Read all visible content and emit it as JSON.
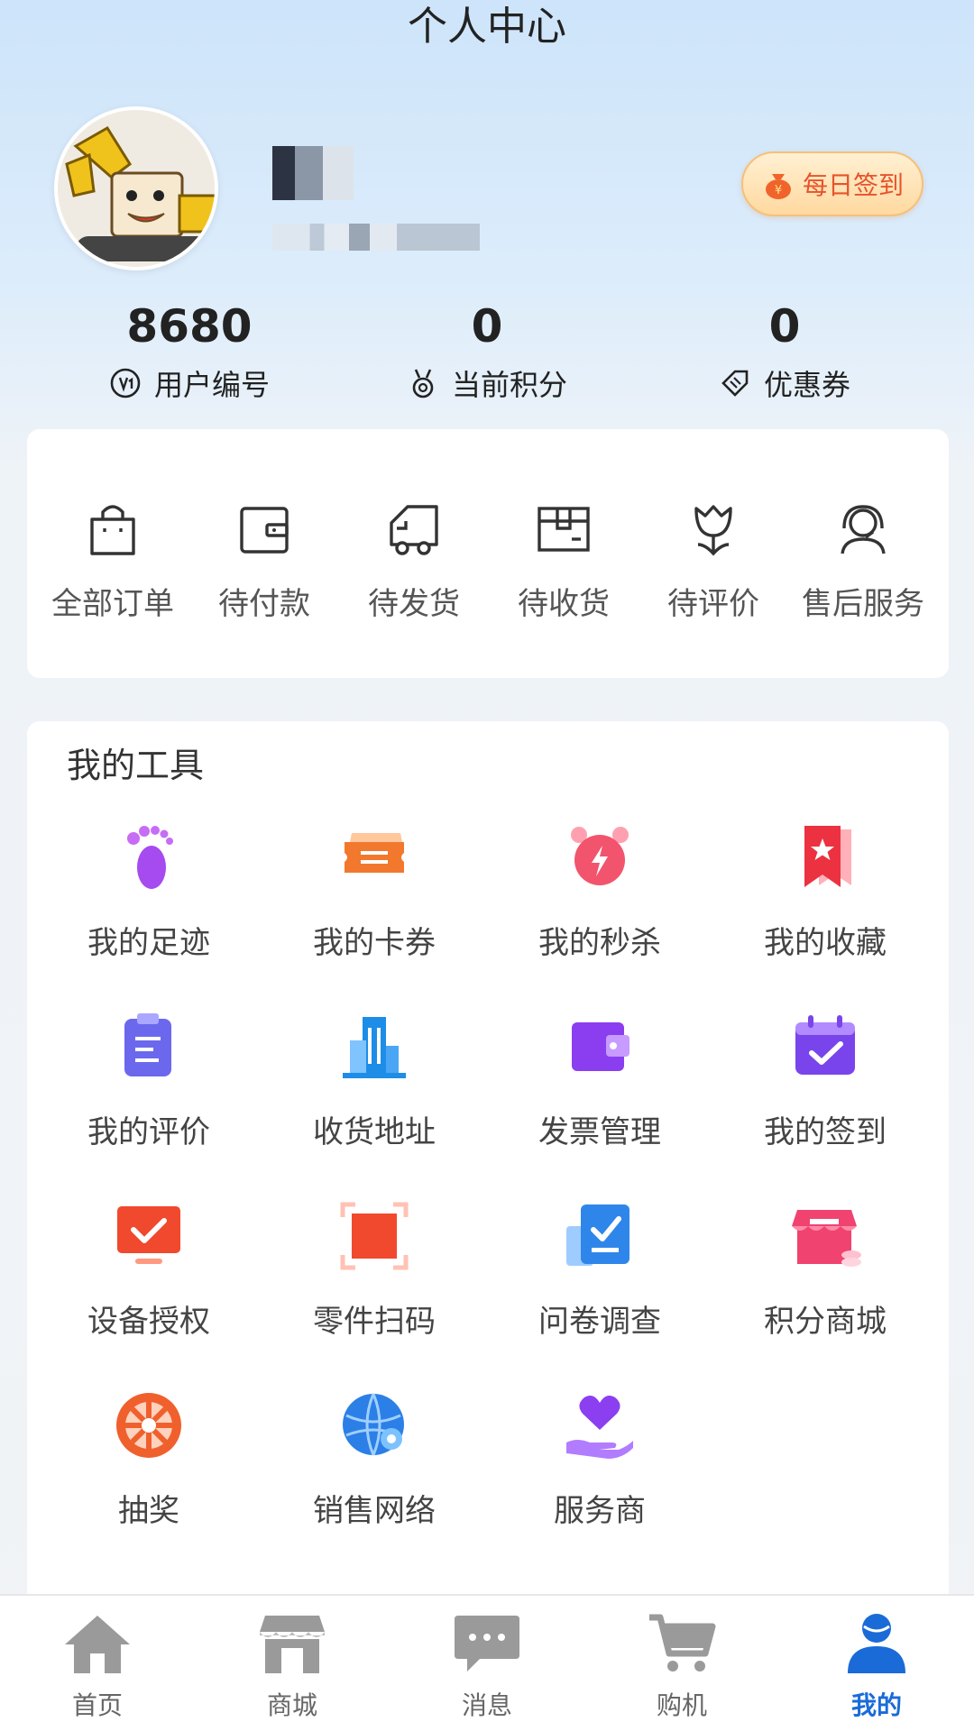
{
  "header": {
    "title": "个人中心"
  },
  "signin": {
    "label": "每日签到"
  },
  "stats": [
    {
      "value": "8680",
      "label": "用户编号",
      "icon": "user-id-icon"
    },
    {
      "value": "0",
      "label": "当前积分",
      "icon": "medal-icon"
    },
    {
      "value": "0",
      "label": "优惠券",
      "icon": "coupon-icon"
    }
  ],
  "orders": [
    {
      "label": "全部订单",
      "icon": "bag-icon"
    },
    {
      "label": "待付款",
      "icon": "wallet-icon"
    },
    {
      "label": "待发货",
      "icon": "truck-icon"
    },
    {
      "label": "待收货",
      "icon": "box-icon"
    },
    {
      "label": "待评价",
      "icon": "flower-icon"
    },
    {
      "label": "售后服务",
      "icon": "headset-icon"
    }
  ],
  "tools": {
    "title": "我的工具",
    "items": [
      {
        "label": "我的足迹",
        "icon": "footprint-icon",
        "color": "#a54bf0"
      },
      {
        "label": "我的卡券",
        "icon": "ticket-icon",
        "color": "#f2782e"
      },
      {
        "label": "我的秒杀",
        "icon": "alarm-clock-icon",
        "color": "#f2546d"
      },
      {
        "label": "我的收藏",
        "icon": "bookmark-star-icon",
        "color": "#ec3141"
      },
      {
        "label": "我的评价",
        "icon": "clipboard-icon",
        "color": "#6b68ee"
      },
      {
        "label": "收货地址",
        "icon": "building-icon",
        "color": "#1d8de8"
      },
      {
        "label": "发票管理",
        "icon": "wallet-purple-icon",
        "color": "#8a3ef0"
      },
      {
        "label": "我的签到",
        "icon": "calendar-check-icon",
        "color": "#7a44ec"
      },
      {
        "label": "设备授权",
        "icon": "monitor-check-icon",
        "color": "#f0492d"
      },
      {
        "label": "零件扫码",
        "icon": "scan-icon",
        "color": "#f0492d"
      },
      {
        "label": "问卷调查",
        "icon": "survey-check-icon",
        "color": "#2f86ea"
      },
      {
        "label": "积分商城",
        "icon": "store-icon",
        "color": "#f04370"
      },
      {
        "label": "抽奖",
        "icon": "wheel-icon",
        "color": "#f0602d"
      },
      {
        "label": "销售网络",
        "icon": "globe-network-icon",
        "color": "#2c7fe6"
      },
      {
        "label": "服务商",
        "icon": "hand-heart-icon",
        "color": "#8b3ff0"
      }
    ]
  },
  "tabbar": [
    {
      "label": "首页",
      "icon": "home-icon"
    },
    {
      "label": "商城",
      "icon": "shop-icon"
    },
    {
      "label": "消息",
      "icon": "message-icon"
    },
    {
      "label": "购机",
      "icon": "cart-icon"
    },
    {
      "label": "我的",
      "icon": "profile-icon",
      "active": true
    }
  ],
  "colors": {
    "accent": "#1a6bd8",
    "tab_inactive": "#999999"
  }
}
